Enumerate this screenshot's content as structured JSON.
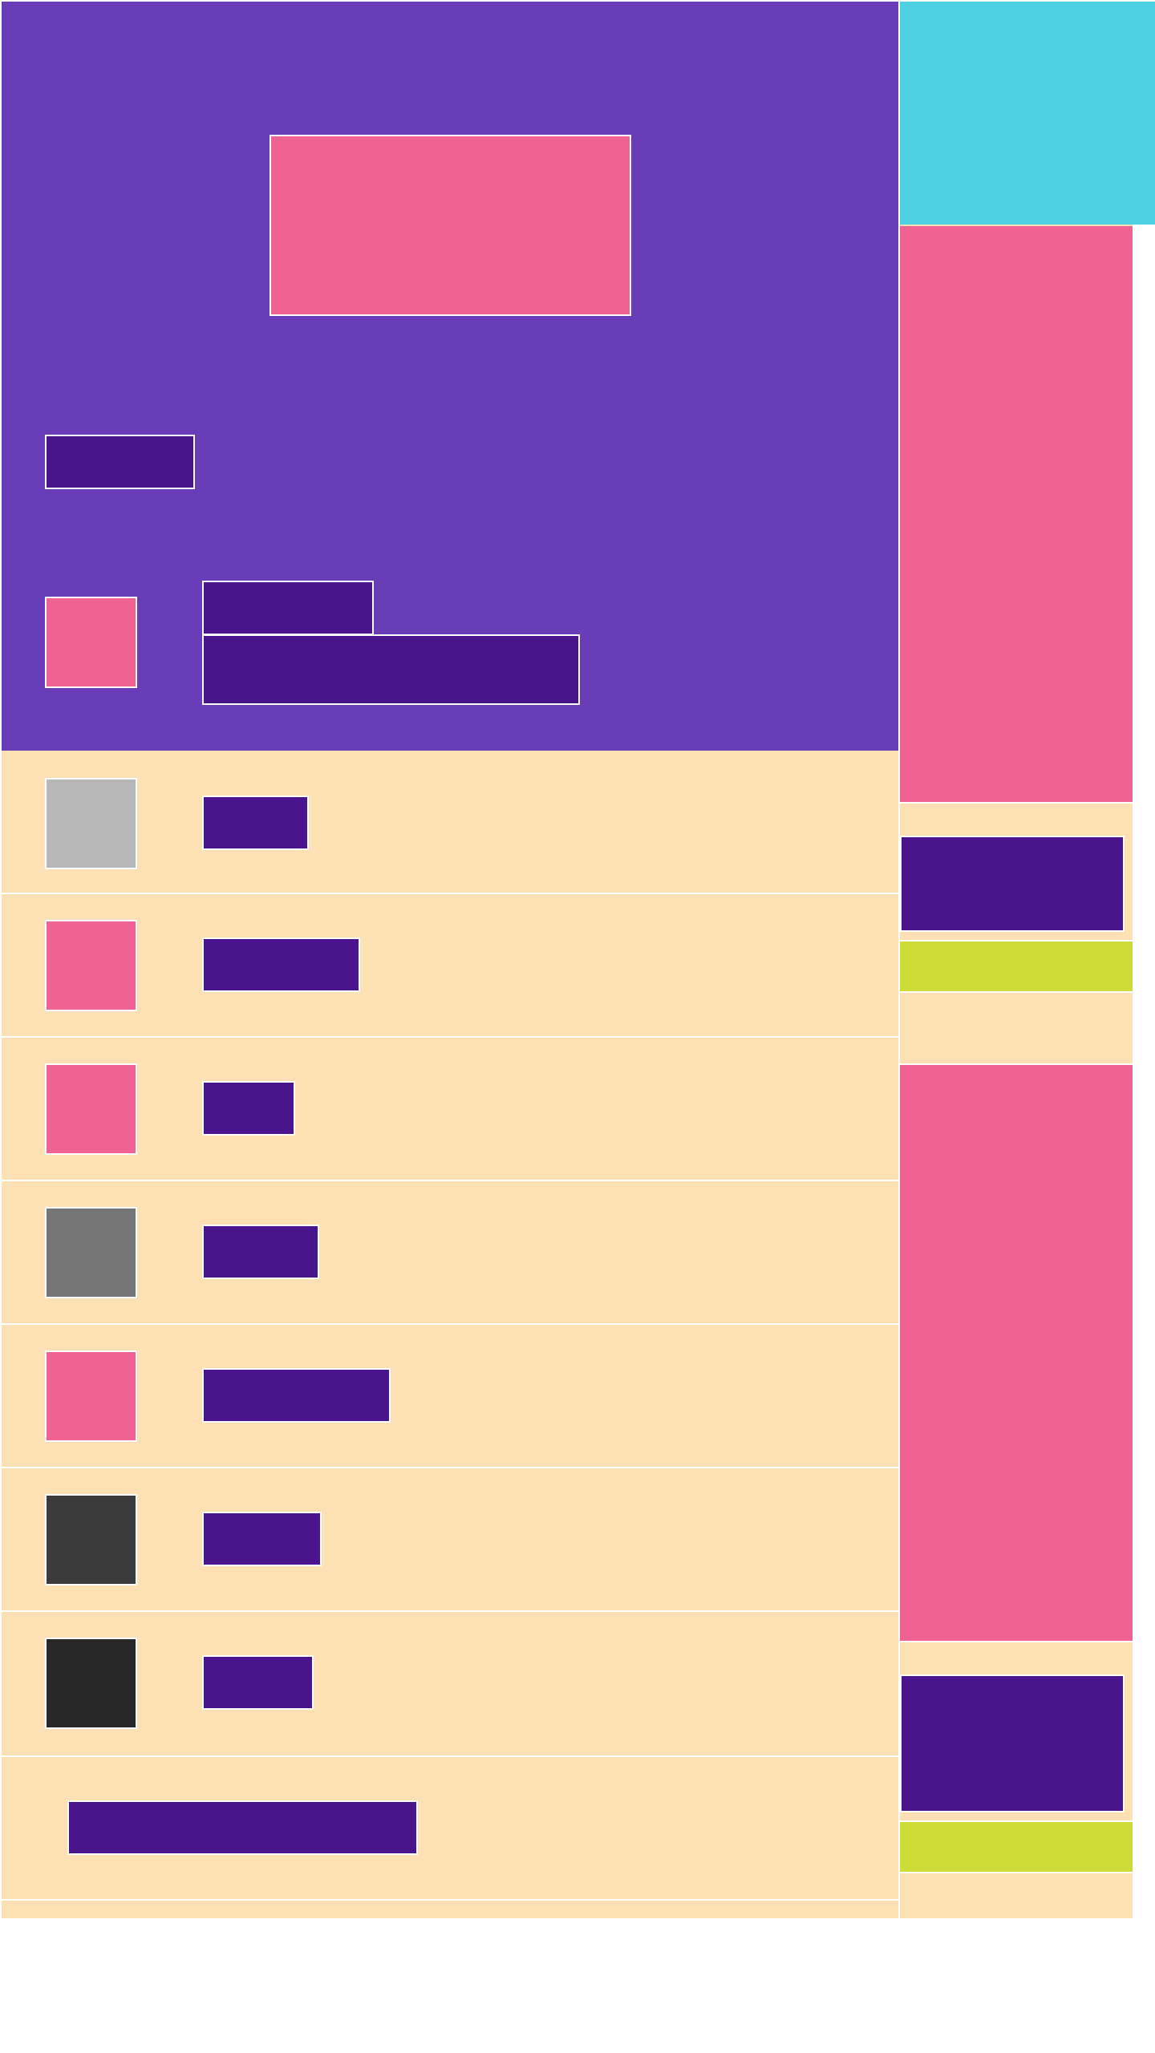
{
  "colors": {
    "header_background": "#6a3db8",
    "list_background": "#fde0b4",
    "accent_pink": "#f06292",
    "accent_indigo": "#4a148c",
    "accent_cyan": "#4dd0e1",
    "accent_lime": "#cddc39"
  },
  "header": {
    "hero_image_icon": "image-placeholder-icon",
    "title": "",
    "profile_avatar_icon": "avatar-placeholder-icon",
    "profile_name": "",
    "profile_subtitle": ""
  },
  "list": {
    "items": [
      {
        "avatar_color": "#b7b7b7",
        "label": ""
      },
      {
        "avatar_color": "#f06292",
        "label": ""
      },
      {
        "avatar_color": "#f06292",
        "label": ""
      },
      {
        "avatar_color": "#767676",
        "label": ""
      },
      {
        "avatar_color": "#f06292",
        "label": ""
      },
      {
        "avatar_color": "#3b3b3b",
        "label": ""
      },
      {
        "avatar_color": "#272727",
        "label": ""
      }
    ],
    "footer_action_label": ""
  },
  "sidebar": {
    "top_panel_color": "#4dd0e1",
    "card_1": {
      "image_color": "#f06292",
      "title": "",
      "action_label": ""
    },
    "card_2": {
      "image_color": "#f06292",
      "title": "",
      "action_label": ""
    }
  }
}
